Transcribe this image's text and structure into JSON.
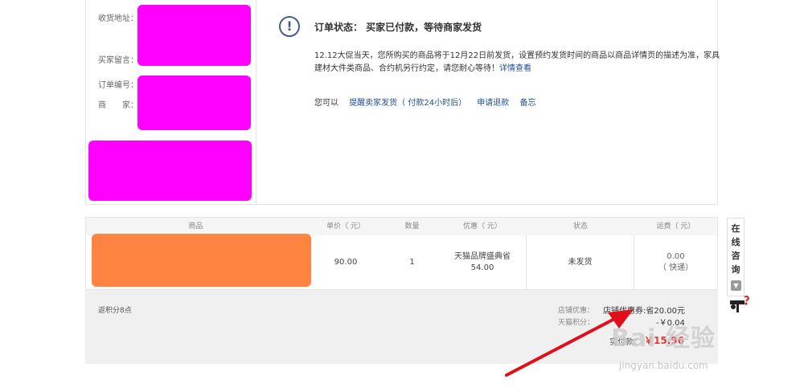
{
  "order_info": {
    "labels": {
      "address": "收货地址：",
      "message": "买家留言：",
      "order_no": "订单编号：",
      "merchant": "商　　家："
    }
  },
  "status": {
    "icon": "exclamation-circle-icon",
    "title": "订单状态：  买家已付款，等待商家发货",
    "notice": "12.12大促当天，您所购买的商品将于12月22日前发货，设置预约发货时间的商品以商品详情页的描述为准，家具建材大件类商品、合约机另行约定，请您耐心等待！",
    "notice_link": "详情查看",
    "actions_prefix": "您可以",
    "actions": [
      "提醒卖家发货（ 付款24小时后）",
      "申请退款",
      "备忘"
    ]
  },
  "table": {
    "headers": [
      "商品",
      "单价（ 元）",
      "数量",
      "优惠（ 元）",
      "状态",
      "运费（ 元）"
    ],
    "row": {
      "price": "90.00",
      "qty": "1",
      "discount_name": "天猫品牌盛典省",
      "discount_value": "54.00",
      "status": "未发货",
      "shipping": "0.00",
      "shipping_type": "（ 快递）"
    }
  },
  "summary": {
    "points": "返积分8点",
    "shop_discount_label": "店铺优惠：",
    "shop_coupon": "店铺优惠券:省20.00元",
    "tmall_points_label": "天猫积分：",
    "tmall_points_value": "-￥0.04",
    "paid_label": "实付款：",
    "paid_value": "￥15.96"
  },
  "side_widget": {
    "label": "在线咨询",
    "icon": "chevron-down-icon"
  },
  "watermark": {
    "brand": "Bai 经验",
    "url": "jingyan.baidu.com"
  },
  "colors": {
    "link": "#1d4f91",
    "mask_magenta": "#ff00ff",
    "mask_orange": "#ff8442",
    "arrow_red": "#e0101a"
  }
}
